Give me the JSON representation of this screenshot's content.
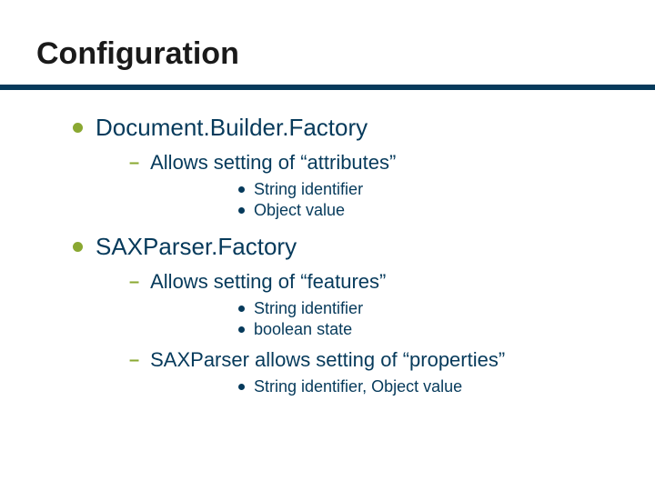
{
  "title": "Configuration",
  "sections": {
    "s0": {
      "heading": "Document.Builder.Factory",
      "sub0": {
        "text": "Allows setting of “attributes”",
        "items": {
          "i0": "String identifier",
          "i1": "Object value"
        }
      }
    },
    "s1": {
      "heading": "SAXParser.Factory",
      "sub0": {
        "text": "Allows setting of “features”",
        "items": {
          "i0": "String identifier",
          "i1": "boolean state"
        }
      },
      "sub1": {
        "text": "SAXParser allows setting of “properties”",
        "items": {
          "i0": "String identifier, Object value"
        }
      }
    }
  }
}
